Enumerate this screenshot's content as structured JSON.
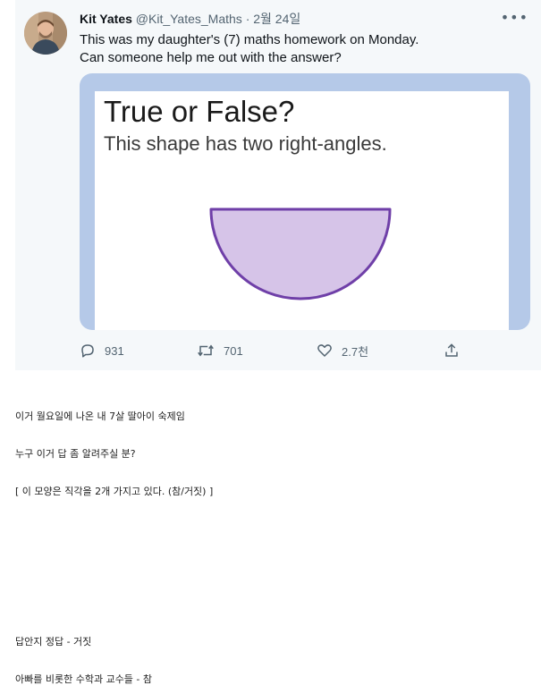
{
  "tweet": {
    "author_name": "Kit Yates",
    "author_handle": "@Kit_Yates_Maths",
    "separator": "·",
    "date": "2월 24일",
    "more_icon": "more-horizontal-icon",
    "text_lines": [
      "This was my daughter's (7) maths homework on Monday.",
      "Can someone help me out with the answer?"
    ],
    "media": {
      "title": "True or False?",
      "subtitle": "This shape has two right-angles.",
      "shape_fill": "#d6c4e8",
      "shape_stroke": "#6f3fa8",
      "frame_color": "#b5c9e8"
    },
    "actions": {
      "reply": {
        "icon": "reply-icon",
        "count": "931"
      },
      "retweet": {
        "icon": "retweet-icon",
        "count": "701"
      },
      "like": {
        "icon": "heart-icon",
        "count": "2.7천"
      },
      "share": {
        "icon": "share-icon"
      }
    }
  },
  "post": {
    "lines": [
      "이거 월요일에 나온 내 7살 딸아이 숙제임",
      "누구 이거 답 좀 알려주실 분?",
      "[ 이 모양은 직각을 2개 가지고 있다. (참/거짓) ]",
      "답안지 정답 - 거짓",
      "아빠를 비롯한 수학과 교수들 - 참"
    ]
  }
}
